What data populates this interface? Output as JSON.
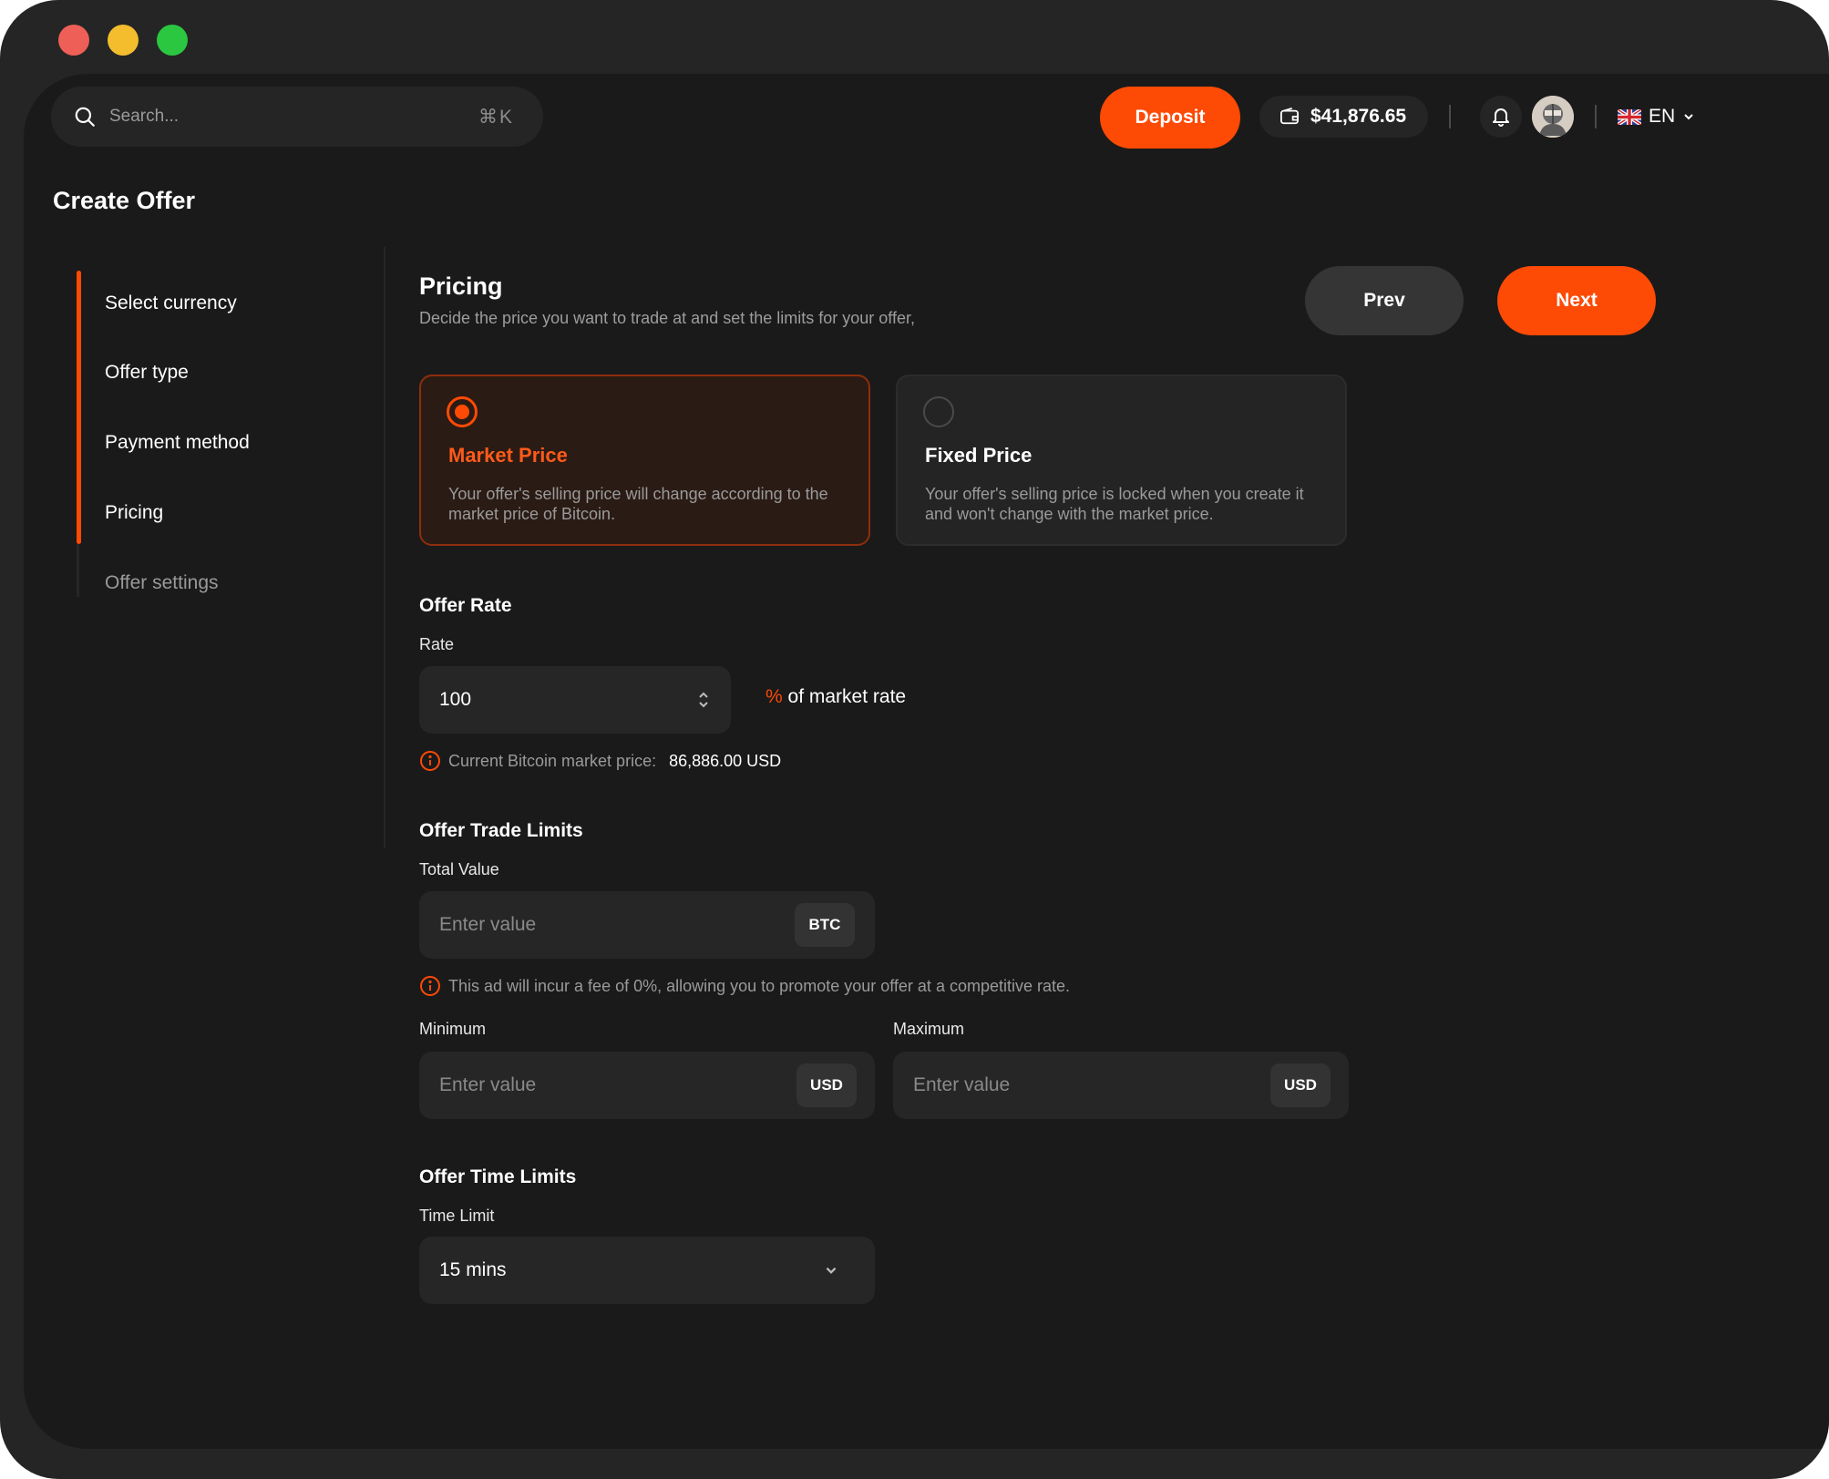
{
  "topbar": {
    "search_placeholder": "Search...",
    "search_shortcut": "⌘K",
    "deposit_label": "Deposit",
    "balance": "$41,876.65",
    "language": "EN"
  },
  "page": {
    "title": "Create Offer"
  },
  "steps": [
    {
      "label": "Select currency",
      "state": "done"
    },
    {
      "label": "Offer type",
      "state": "done"
    },
    {
      "label": "Payment method",
      "state": "done"
    },
    {
      "label": "Pricing",
      "state": "current"
    },
    {
      "label": "Offer settings",
      "state": "upcoming"
    }
  ],
  "pricing": {
    "title": "Pricing",
    "subtitle": "Decide the price you want to trade at and set the limits for your offer,",
    "prev_label": "Prev",
    "next_label": "Next",
    "options": [
      {
        "title": "Market Price",
        "description": "Your offer's selling price will change according to the market price of Bitcoin.",
        "selected": true
      },
      {
        "title": "Fixed Price",
        "description": "Your offer's selling price is locked when you create it and won't change with the market price.",
        "selected": false
      }
    ]
  },
  "offer_rate": {
    "heading": "Offer Rate",
    "rate_label": "Rate",
    "rate_value": "100",
    "rate_suffix_symbol": "%",
    "rate_suffix_text": "of market rate",
    "market_price_label": "Current Bitcoin market price:",
    "market_price_value": "86,886.00 USD"
  },
  "trade_limits": {
    "heading": "Offer Trade Limits",
    "total_label": "Total Value",
    "total_placeholder": "Enter value",
    "total_unit": "BTC",
    "fee_note": "This ad will incur a fee of 0%, allowing you to promote your offer at a competitive rate.",
    "min_label": "Minimum",
    "min_placeholder": "Enter value",
    "min_unit": "USD",
    "max_label": "Maximum",
    "max_placeholder": "Enter value",
    "max_unit": "USD"
  },
  "time_limits": {
    "heading": "Offer Time Limits",
    "label": "Time Limit",
    "value": "15 mins"
  },
  "colors": {
    "accent": "#fd4a05",
    "background": "#1a1a1a",
    "surface": "#262626"
  }
}
